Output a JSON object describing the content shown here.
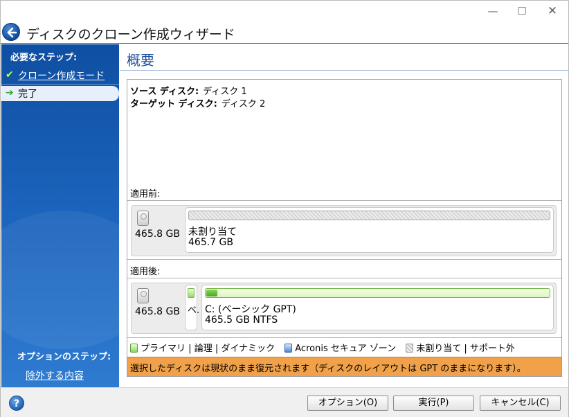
{
  "window": {
    "title": "ディスクのクローン作成ウィザード",
    "controls": {
      "minimize": "—",
      "maximize": "☐",
      "close": "✕"
    }
  },
  "sidebar": {
    "required_heading": "必要なステップ:",
    "steps": [
      {
        "label": "クローン作成モード",
        "icon": "check-icon",
        "state": "completed"
      },
      {
        "label": "完了",
        "icon": "arrow-right-icon",
        "state": "current"
      }
    ],
    "optional_heading": "オプションのステップ:",
    "optional_link": "除外する内容"
  },
  "main": {
    "page_title": "概要",
    "source_label": "ソース ディスク:",
    "source_value": "ディスク 1",
    "target_label": "ターゲット ディスク:",
    "target_value": "ディスク 2",
    "before": {
      "label": "適用前:",
      "disk_size": "465.8 GB",
      "partition_name": "未割り当て",
      "partition_size": "465.7 GB"
    },
    "after": {
      "label": "適用後:",
      "disk_size": "465.8 GB",
      "small_partition_text": "ベ.",
      "partition_name": "C: (ベーシック GPT)",
      "partition_detail": "465.5 GB  NTFS"
    },
    "legend": {
      "primary": "プライマリ",
      "logical": "論理",
      "dynamic": "ダイナミック",
      "acronis": "Acronis セキュア ゾーン",
      "unallocated": "未割り当て",
      "unsupported": "サポート外",
      "sep": "|"
    },
    "note": "選択したディスクは現状のまま復元されます（ディスクのレイアウトは GPT のままになります）。"
  },
  "footer": {
    "help": "?",
    "options_button": "オプション(O)",
    "run_button": "実行(P)",
    "cancel_button": "キャンセル(C)"
  },
  "colors": {
    "sidebar_blue": "#1d66bf",
    "title_blue": "#1a4f9a",
    "note_orange": "#f0a14a",
    "primary_green": "#8fd45a",
    "acronis_blue": "#4b86d6"
  }
}
